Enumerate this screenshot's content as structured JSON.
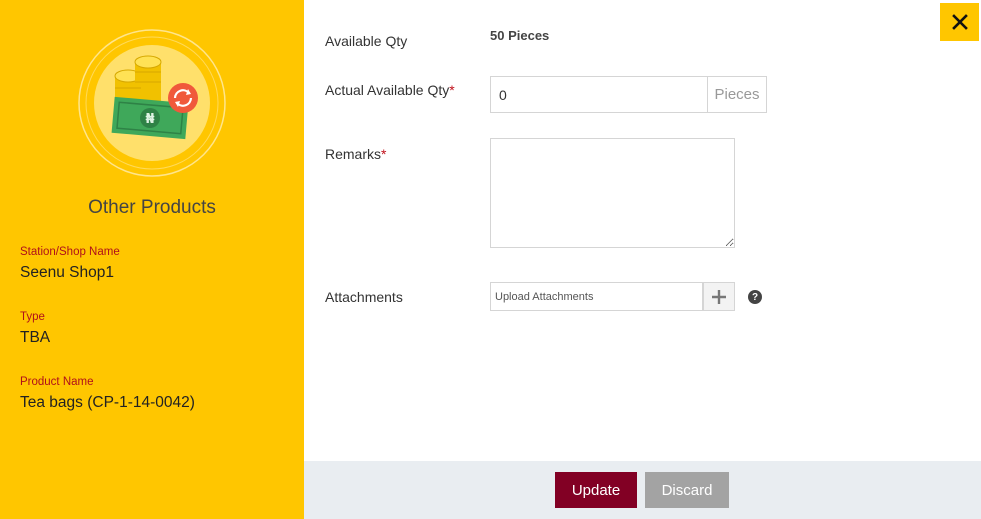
{
  "summary": {
    "title": "Other Products",
    "fields": [
      {
        "label": "Station/Shop Name",
        "value": "Seenu Shop1"
      },
      {
        "label": "Type",
        "value": "TBA"
      },
      {
        "label": "Product Name",
        "value": "Tea bags (CP-1-14-0042)"
      }
    ]
  },
  "form": {
    "available_qty": {
      "label": "Available Qty",
      "value": "50 Pieces"
    },
    "actual_qty": {
      "label": "Actual Available Qty",
      "required_mark": "*",
      "value": "0",
      "unit": "Pieces"
    },
    "remarks": {
      "label": "Remarks",
      "required_mark": "*",
      "value": ""
    },
    "attachments": {
      "label": "Attachments",
      "placeholder": "Upload Attachments",
      "help_glyph": "?"
    }
  },
  "actions": {
    "update_label": "Update",
    "discard_label": "Discard"
  },
  "colors": {
    "panel": "#ffc600",
    "primary": "#820024",
    "secondary": "#a3a3a3",
    "footer": "#e9edf1"
  }
}
